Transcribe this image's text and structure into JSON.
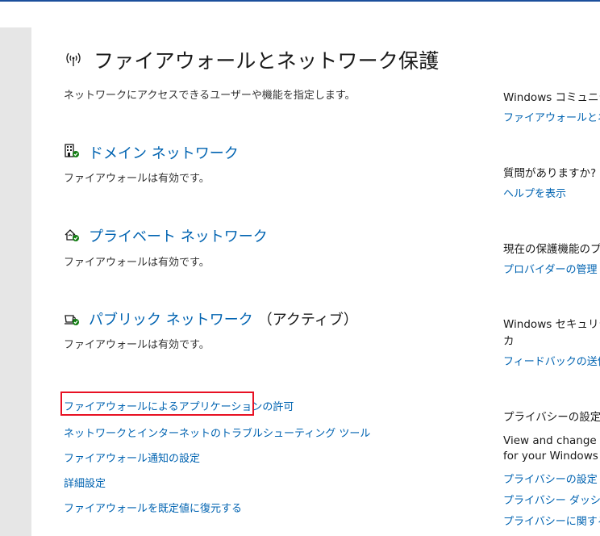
{
  "header": {
    "title": "ファイアウォールとネットワーク保護",
    "subtitle": "ネットワークにアクセスできるユーザーや機能を指定します。",
    "title_icon": "wireless-antenna-icon"
  },
  "networks": [
    {
      "name": "ドメイン ネットワーク",
      "status": "ファイアウォールは有効です。",
      "active": "",
      "icon": "domain-building-icon"
    },
    {
      "name": "プライベート ネットワーク",
      "status": "ファイアウォールは有効です。",
      "active": "",
      "icon": "private-home-icon"
    },
    {
      "name": "パブリック ネットワーク",
      "status": "ファイアウォールは有効です。",
      "active": "（アクティブ）",
      "icon": "public-coffee-icon"
    }
  ],
  "links": [
    {
      "label": "ファイアウォールによるアプリケーションの許可",
      "highlighted": true
    },
    {
      "label": "ネットワークとインターネットのトラブルシューティング ツール"
    },
    {
      "label": "ファイアウォール通知の設定"
    },
    {
      "label": "詳細設定"
    },
    {
      "label": "ファイアウォールを既定値に復元する"
    }
  ],
  "sidebar": {
    "community_heading": "Windows コミュニティ",
    "community_link": "ファイアウォールとネット",
    "question_heading": "質問がありますか?",
    "help_link": "ヘルプを表示",
    "providers_heading": "現在の保護機能のプ",
    "providers_link": "プロバイダーの管理",
    "feedback_heading_line1": "Windows セキュリテ",
    "feedback_heading_line2": "カ",
    "feedback_link": "フィードバックの送信",
    "privacy_heading": "プライバシーの設定を",
    "privacy_text_line1": "View and change p",
    "privacy_text_line2": "for your Windows",
    "privacy_link1": "プライバシーの設定",
    "privacy_link2": "プライバシー ダッシュボ",
    "privacy_link3": "プライバシーに関する声"
  },
  "colors": {
    "accent": "#0063b1",
    "highlight_border": "#e81123",
    "status_ok": "#107c10"
  }
}
